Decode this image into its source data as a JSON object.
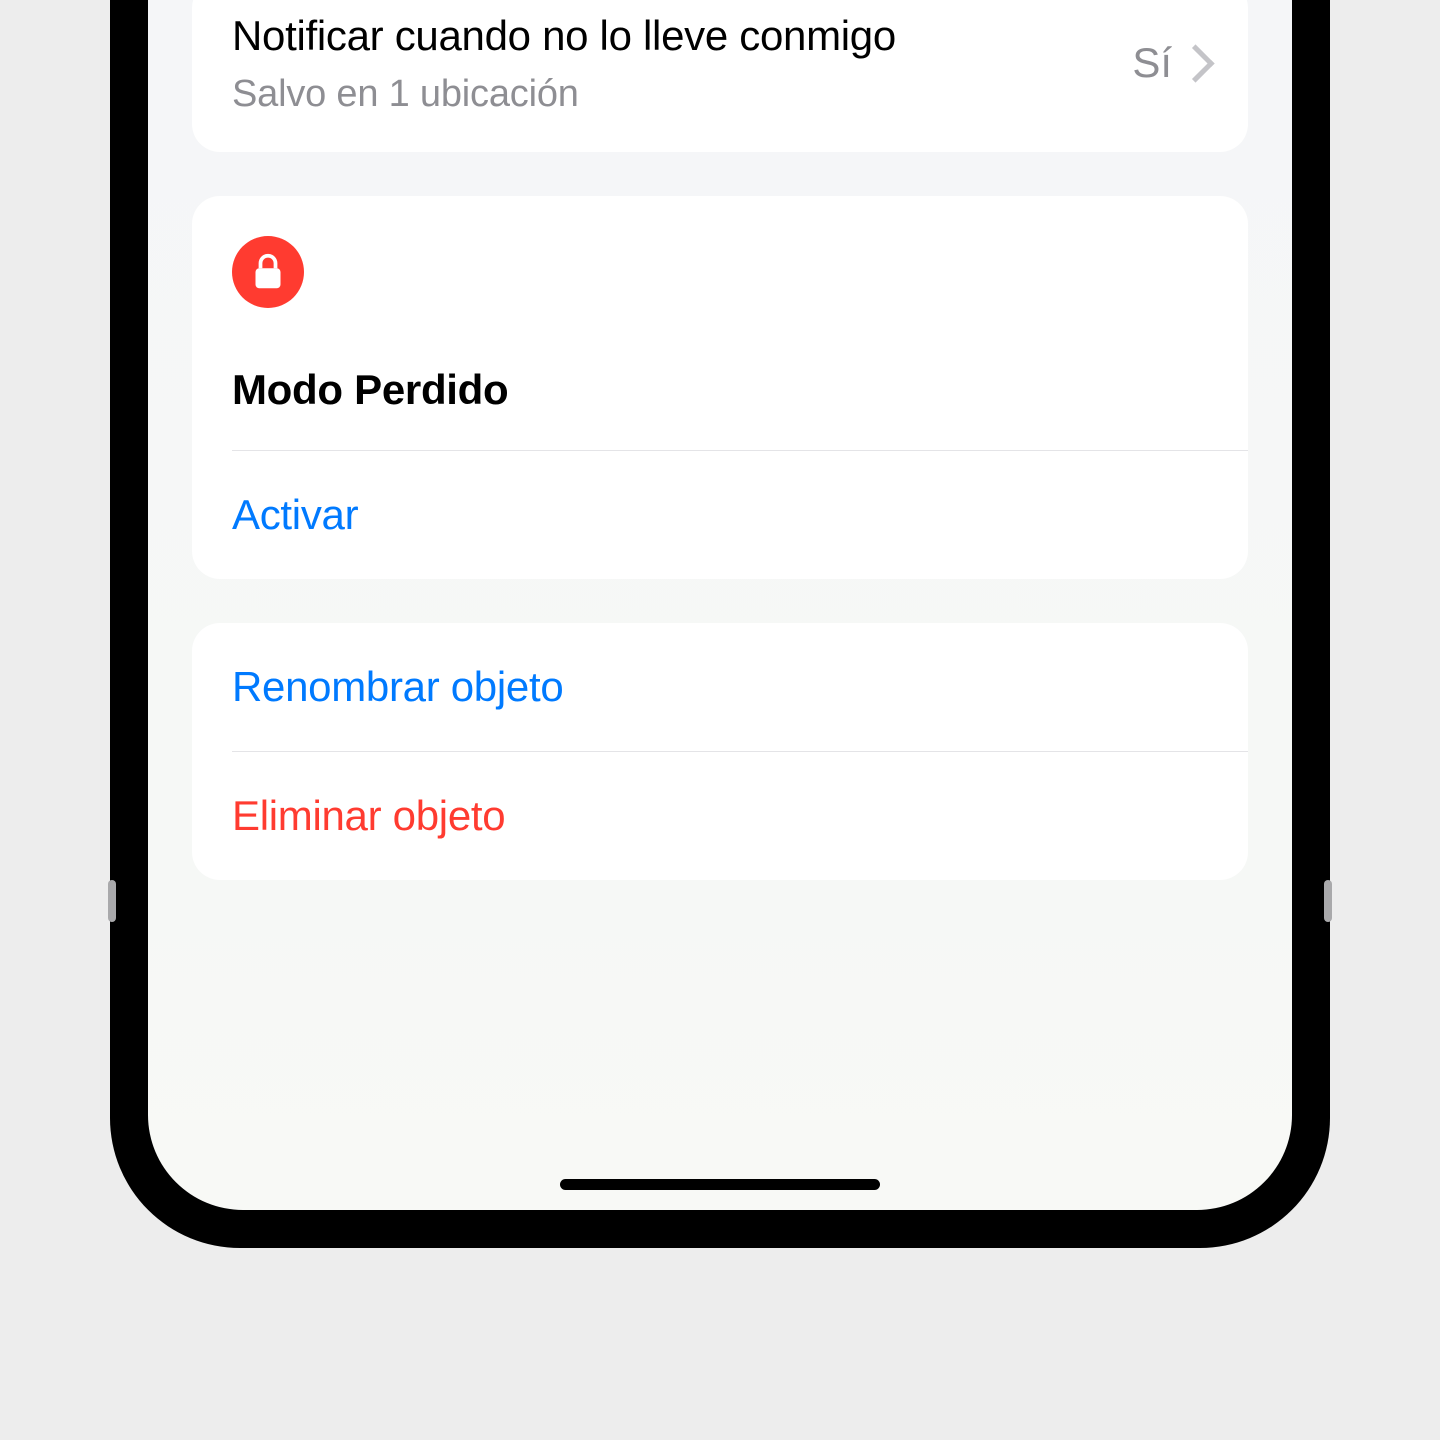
{
  "notify": {
    "title": "Notificar cuando no lo lleve conmigo",
    "subtitle": "Salvo en 1 ubicación",
    "value": "Sí"
  },
  "lostMode": {
    "title": "Modo Perdido",
    "activate": "Activar"
  },
  "actions": {
    "rename": "Renombrar objeto",
    "remove": "Eliminar objeto"
  }
}
